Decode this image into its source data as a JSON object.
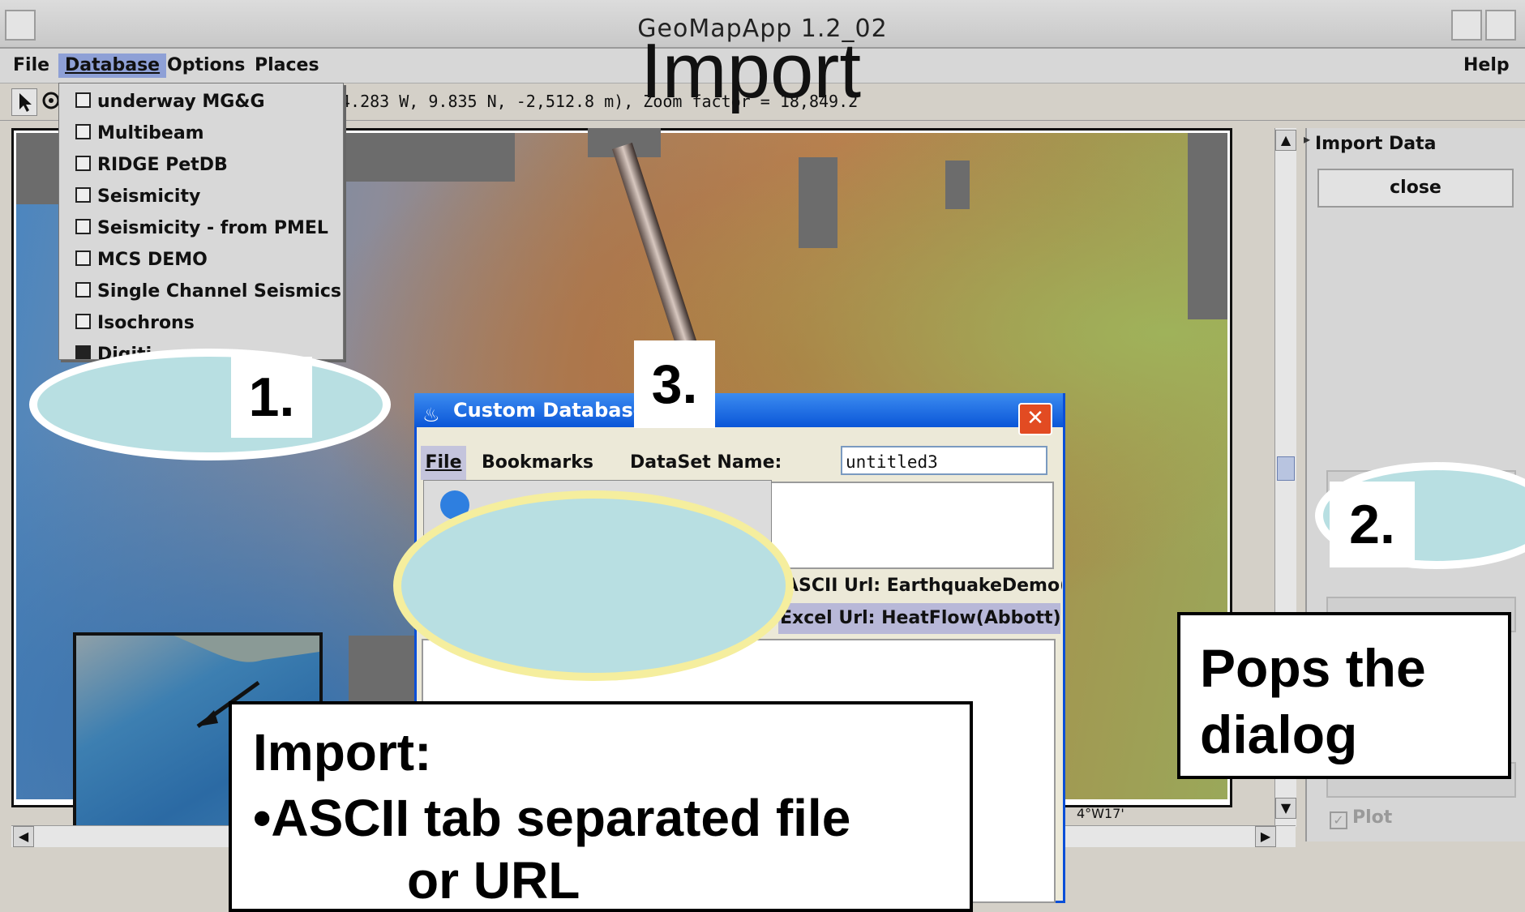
{
  "window": {
    "title": "GeoMapApp 1.2_02"
  },
  "menubar": {
    "file": "File",
    "database": "Database",
    "options": "Options",
    "places": "Places",
    "help": "Help"
  },
  "coordinate_readout": "4.283 W, 9.835 N, -2,512.8 m), Zoom factor = 18,849.2",
  "database_menu": {
    "items": [
      {
        "label": "underway MG&G",
        "checked": false
      },
      {
        "label": "Multibeam",
        "checked": false
      },
      {
        "label": "RIDGE PetDB",
        "checked": false
      },
      {
        "label": "Seismicity",
        "checked": false
      },
      {
        "label": "Seismicity - from PMEL",
        "checked": false
      },
      {
        "label": "MCS DEMO",
        "checked": false
      },
      {
        "label": "Single Channel Seismics",
        "checked": false
      },
      {
        "label": "Isochrons",
        "checked": false
      },
      {
        "label": "Digiti",
        "checked": true
      }
    ]
  },
  "right_panel": {
    "title": "Import Data",
    "close_label": "close",
    "plot_label": "Plot",
    "plot_checked": true
  },
  "map": {
    "scale_label": "4°W17'"
  },
  "dialog": {
    "title": "Custom Database",
    "menu_file": "File",
    "menu_bookmarks": "Bookmarks",
    "dataset_label": "DataSet Name:",
    "dataset_value": "untitled3",
    "bookmarks": [
      "ASCII Url: EarthquakeDemo(IRIS",
      "Excel Url: HeatFlow(Abbott)"
    ]
  },
  "slide": {
    "title": "Import",
    "step1": "1.",
    "step2": "2.",
    "step3": "3.",
    "callout_right": "Pops the dialog",
    "callout_main_heading": "Import:",
    "callout_main_bullet": "•ASCII tab separated file",
    "callout_main_cont": "or URL"
  }
}
